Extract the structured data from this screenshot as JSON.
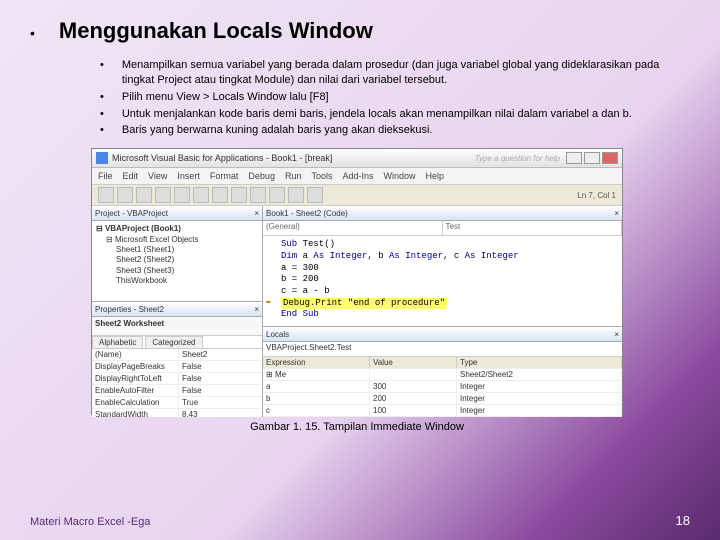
{
  "slide": {
    "title": "Menggunakan Locals Window",
    "bullets": [
      "Menampilkan semua variabel yang berada dalam prosedur (dan juga variabel global yang dideklarasikan pada tingkat Project atau tingkat Module) dan nilai dari variabel tersebut.",
      "Pilih menu View > Locals Window lalu [F8]",
      "Untuk menjalankan kode baris demi baris, jendela locals akan menampilkan nilai dalam variabel a dan b.",
      "Baris yang berwarna kuning adalah baris yang akan dieksekusi."
    ],
    "caption": "Gambar 1. 15. Tampilan Immediate Window",
    "footer": "Materi Macro Excel -Ega",
    "page": "18"
  },
  "vbe": {
    "title": "Microsoft Visual Basic for Applications - Book1 - [break]",
    "search_prompt": "Type a question for help",
    "cursor_pos": "Ln 7, Col 1",
    "menu": [
      "File",
      "Edit",
      "View",
      "Insert",
      "Format",
      "Debug",
      "Run",
      "Tools",
      "Add-Ins",
      "Window",
      "Help"
    ],
    "project": {
      "header": "Project - VBAProject",
      "root": "VBAProject (Book1)",
      "folder": "Microsoft Excel Objects",
      "items": [
        "Sheet1 (Sheet1)",
        "Sheet2 (Sheet2)",
        "Sheet3 (Sheet3)",
        "ThisWorkbook"
      ]
    },
    "properties": {
      "header": "Properties - Sheet2",
      "object": "Sheet2 Worksheet",
      "tabs": [
        "Alphabetic",
        "Categorized"
      ],
      "rows": [
        {
          "k": "(Name)",
          "v": "Sheet2"
        },
        {
          "k": "DisplayPageBreaks",
          "v": "False"
        },
        {
          "k": "DisplayRightToLeft",
          "v": "False"
        },
        {
          "k": "EnableAutoFilter",
          "v": "False"
        },
        {
          "k": "EnableCalculation",
          "v": "True"
        },
        {
          "k": "StandardWidth",
          "v": "8,43"
        }
      ]
    },
    "code": {
      "header": "Book1 - Sheet2 (Code)",
      "dd1": "(General)",
      "dd2": "Test",
      "lines": {
        "l1a": "Sub",
        "l1b": " Test()",
        "l2a": "Dim",
        "l2b": " a ",
        "l2c": "As Integer",
        "l2d": ", b ",
        "l2e": "As Integer",
        "l2f": ", c ",
        "l2g": "As Integer",
        "l3": "a = 300",
        "l4": "b = 200",
        "l5": "c = a - b",
        "l6": "Debug.Print \"end of procedure\"",
        "l7": "End Sub"
      }
    },
    "locals": {
      "header": "Locals",
      "context": "VBAProject.Sheet2.Test",
      "cols": [
        "Expression",
        "Value",
        "Type"
      ],
      "rows": [
        {
          "e": "Me",
          "v": "",
          "t": "Sheet2/Sheet2"
        },
        {
          "e": "a",
          "v": "300",
          "t": "Integer"
        },
        {
          "e": "b",
          "v": "200",
          "t": "Integer"
        },
        {
          "e": "c",
          "v": "100",
          "t": "Integer"
        }
      ]
    }
  }
}
